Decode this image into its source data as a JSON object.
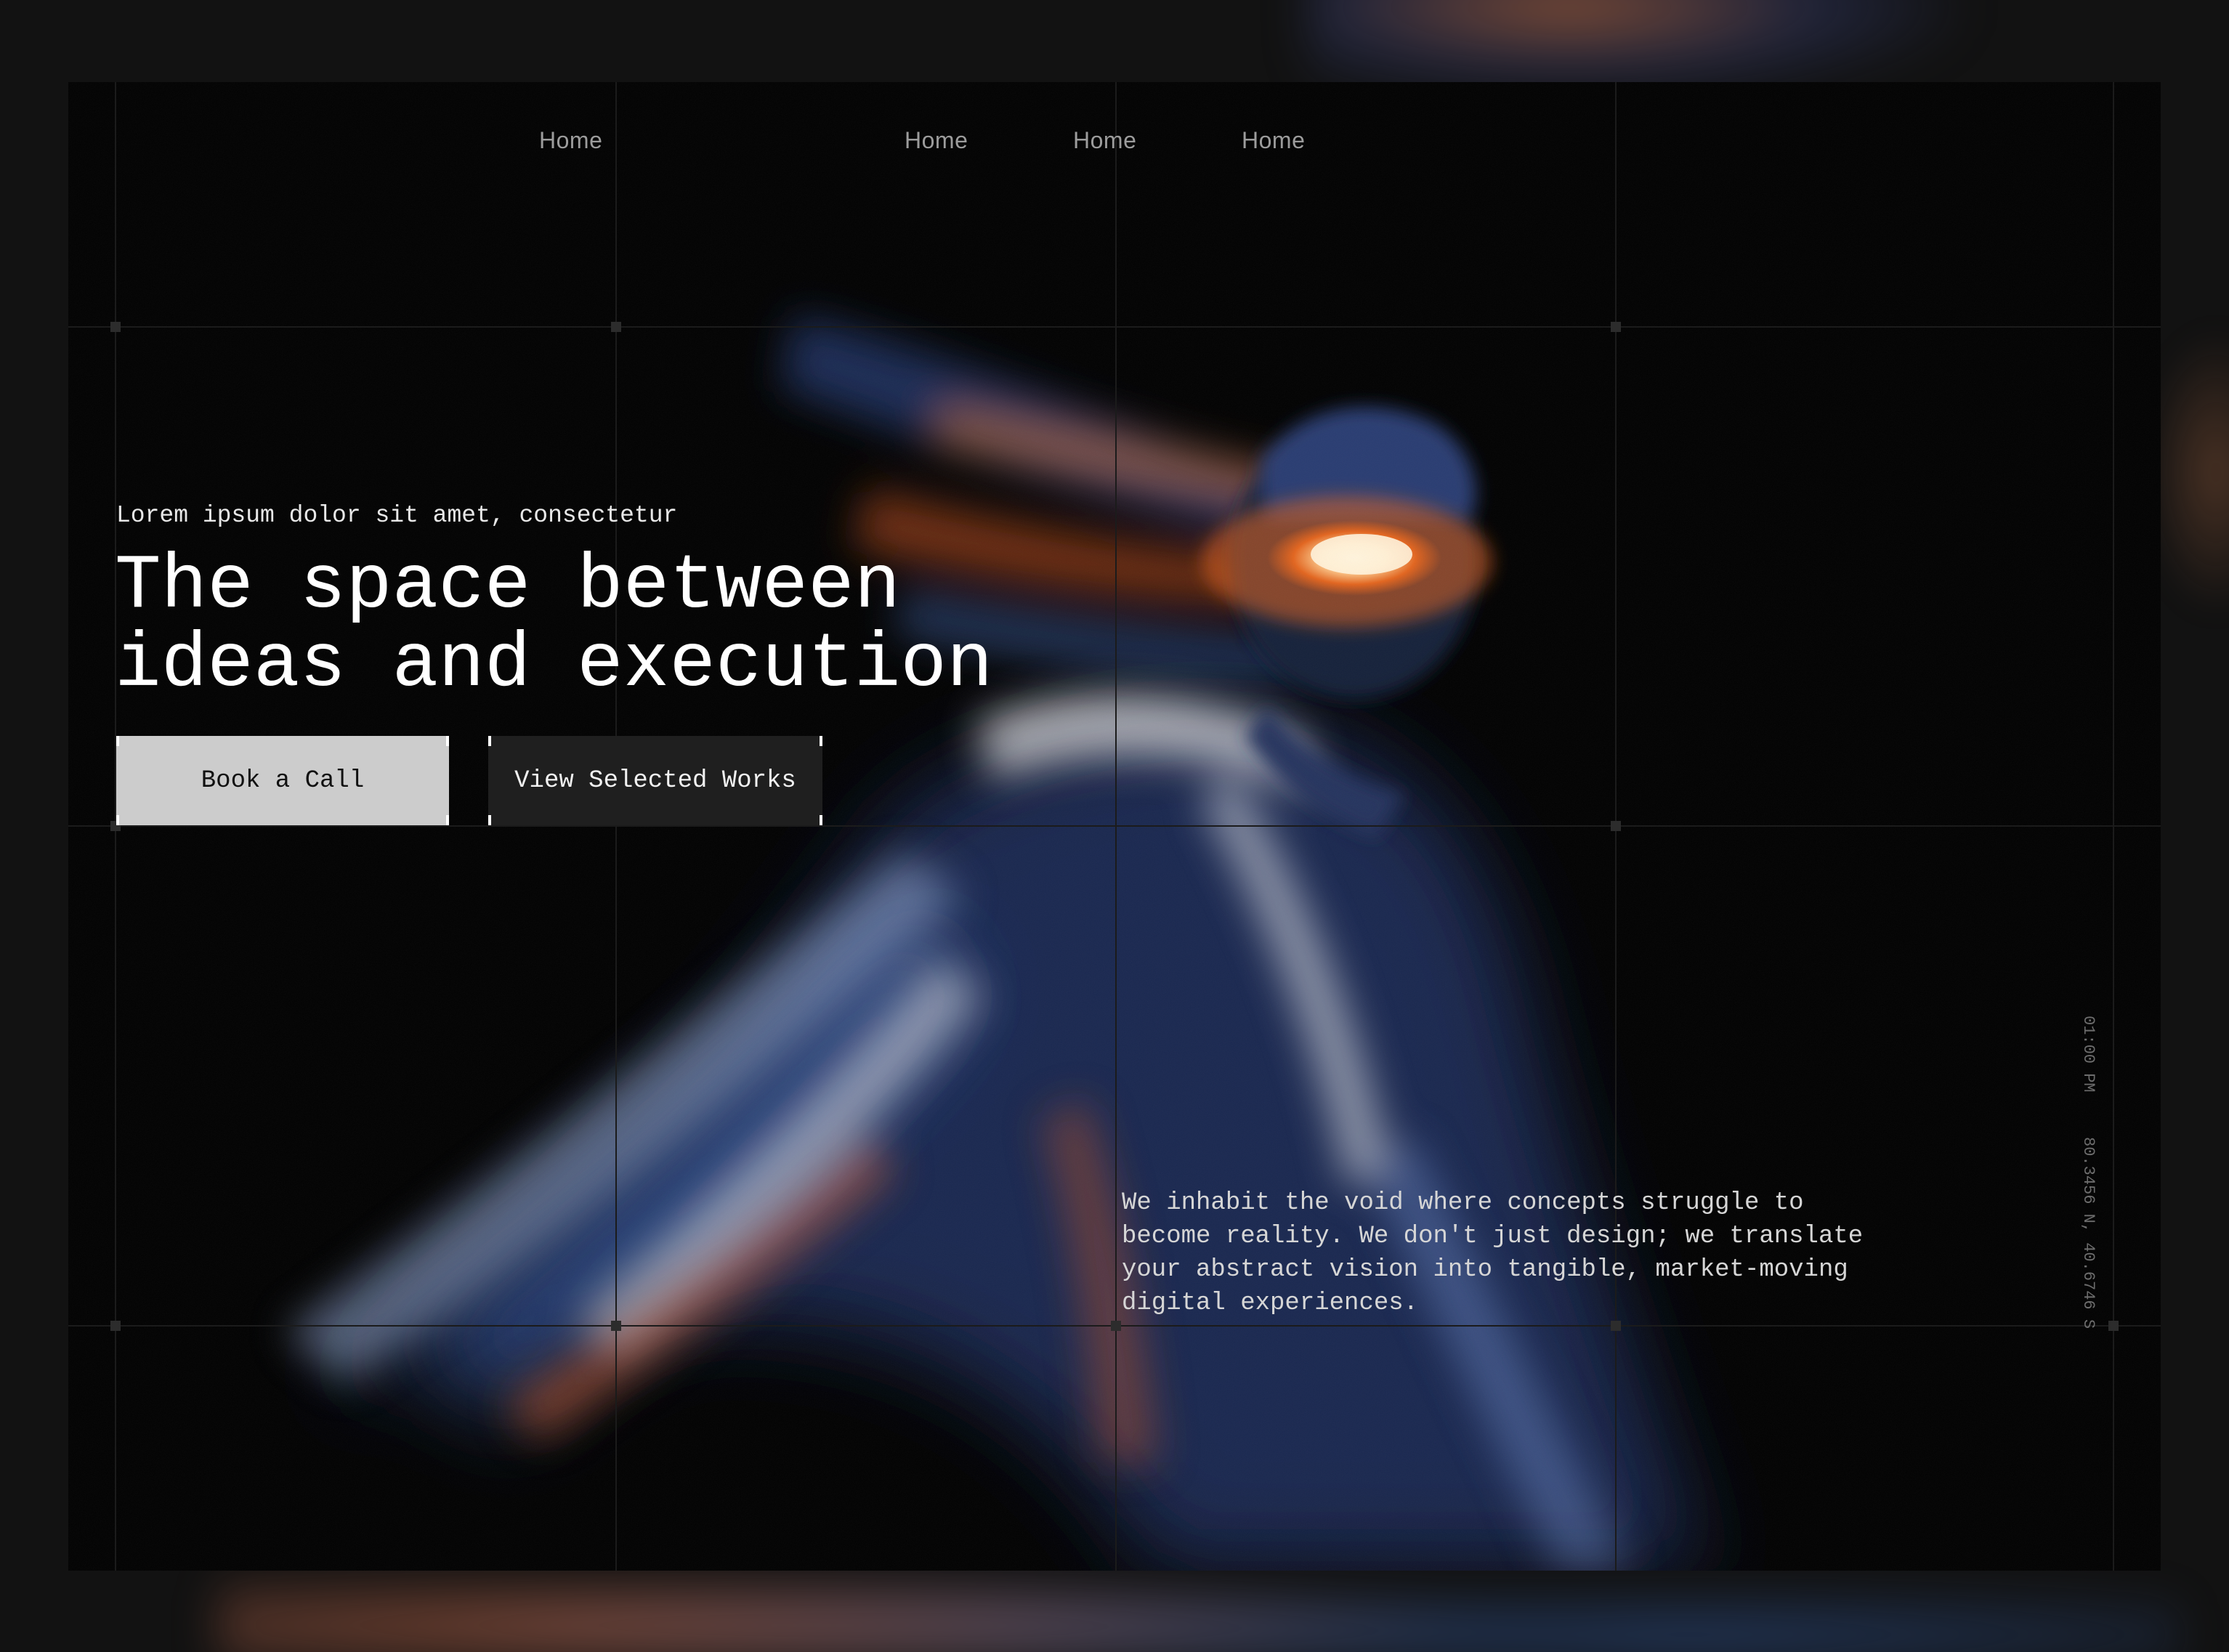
{
  "nav": {
    "links": [
      "Home",
      "Home",
      "Home",
      "Home"
    ]
  },
  "hero": {
    "eyebrow": "Lorem ipsum dolor sit amet, consectetur",
    "headline_line1": "The space between",
    "headline_line2": "ideas and execution",
    "primary_cta": "Book a Call",
    "secondary_cta": "View Selected Works",
    "description": "We inhabit the void where concepts struggle to become reality. We don't just design; we translate your abstract vision into tangible, market-moving digital experiences."
  },
  "meta": {
    "time": "01:00 PM",
    "coordinates": "80.3456 N, 40.6746 S"
  },
  "colors": {
    "background": "#030303",
    "outer": "#121212",
    "primary_button": "#cccccc",
    "secondary_button": "#1f1f1f",
    "accent_warm": "#d86a3a",
    "accent_cool": "#3f6fc0"
  },
  "icons": {
    "hero_image": "motion-blur-figure-with-glowing-visor"
  }
}
